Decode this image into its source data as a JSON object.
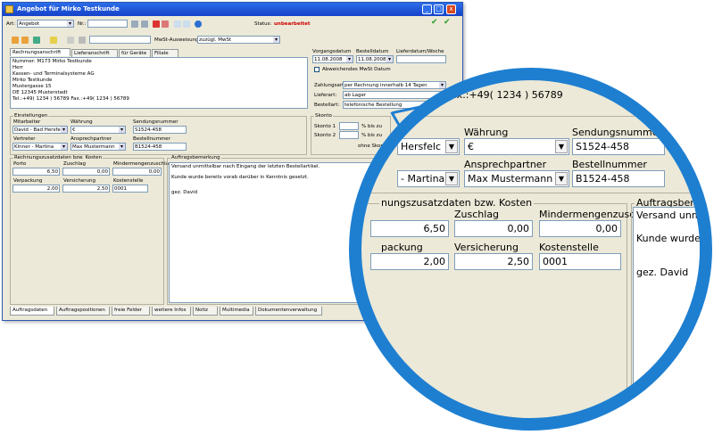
{
  "window": {
    "title": "Angebot für Mirko Testkunde",
    "min": "_",
    "max": "□",
    "close": "x"
  },
  "toolbar1": {
    "art_label": "Art:",
    "art_value": "Angebot",
    "nr_label": "Nr.:",
    "nr_value": "",
    "status_label": "Status:",
    "status_value": "unbearbeitet"
  },
  "toolbar2": {
    "mwst_label": "MwSt-Ausweisung:",
    "mwst_value": "zuzügl. MwSt"
  },
  "tabs": [
    "Rechnungsanschrift",
    "Lieferanschrift",
    "für Geräte",
    "Filiale"
  ],
  "address": {
    "lines": [
      "Nummer: M173  Mirko Testkunde",
      "Herr",
      "Kassen- und Terminalsysteme AG",
      "Mirko Testkunde",
      "Mustergasse 15",
      "DE 12345 Musterstadt",
      "Tel.:+49( 1234 ) 56789     Fax.:+49( 1234 ) 56789"
    ]
  },
  "dates": {
    "vorgang_label": "Vorgangsdatum",
    "vorgang_value": "11.08.2008",
    "bestell_label": "Bestelldatum",
    "bestell_value": "11.08.2008",
    "liefer_label": "Lieferdatum/Woche",
    "liefer_value": "",
    "abw_label": "Abweichendes MwSt Datum"
  },
  "payment": {
    "zahlungsart_label": "Zahlungsart:",
    "zahlungsart_value": "per Rechnung innerhalb 14 Tagen",
    "lieferart_label": "Lieferart:",
    "lieferart_value": "ab Lager",
    "bestellart_label": "Bestellart:",
    "bestellart_value": "telefonische Bestellung"
  },
  "settings": {
    "title": "Einstellungen",
    "mitarbeiter_label": "Mitarbeiter",
    "mitarbeiter_value": "David - Bad Hersfeld",
    "waehrung_label": "Währung",
    "waehrung_value": "€",
    "sendungsnummer_label": "Sendungsnummer",
    "sendungsnummer_value": "S1524-458",
    "vertreter_label": "Vertreter",
    "vertreter_value": "Kinner - Martina",
    "ansprech_label": "Ansprechpartner",
    "ansprech_value": "Max Mustermann",
    "bestellnummer_label": "Bestellnummer",
    "bestellnummer_value": "B1524-458"
  },
  "skonto": {
    "title": "Skonto",
    "s1_label": "Skonto 1",
    "s2_label": "Skonto 2",
    "pct_label": "% bis zu",
    "ohne_label": "ohne Skonto in"
  },
  "costs": {
    "title": "Rechnungszusatzdaten bzw. Kosten",
    "porto_label": "Porto",
    "porto_value": "6,50",
    "zuschlag_label": "Zuschlag",
    "zuschlag_value": "0,00",
    "minder_label": "Mindermengenzuschlag",
    "minder_value": "0,00",
    "verpackung_label": "Verpackung",
    "verpackung_value": "2,00",
    "versicherung_label": "Versicherung",
    "versicherung_value": "2,50",
    "kostenstelle_label": "Kostenstelle",
    "kostenstelle_value": "0001"
  },
  "remark": {
    "title": "Auftragsbemerkung",
    "line1": "Versand unmittelbar nach Eingang der letzten Bestellartikel.",
    "line2": "Kunde wurde bereits vorab darüber in Kenntnis gesetzt.",
    "line3": "gez. David"
  },
  "bottom_tabs": [
    "Auftragsdaten",
    "Auftragspositionen",
    "freie Felder",
    "weitere Infos",
    "Notiz",
    "Multimedia",
    "Dokumentenverwaltung"
  ],
  "zoom": {
    "tel_text": "ax.:+49( 1234 ) 56789",
    "mitarbeiter_value": "Hersfelc",
    "waehrung_label": "Währung",
    "waehrung_value": "€",
    "sendungsnummer_label": "Sendungsnummer",
    "sendungsnummer_value": "S1524-458",
    "ansprech_label": "Ansprechpartner",
    "ansprech_value": "Max Mustermann",
    "bestellnummer_label": "Bestellnummer",
    "bestellnummer_value": "B1524-458",
    "vertreter_value": "- Martina",
    "costs_title": "nungszusatzdaten bzw. Kosten",
    "zuschlag_label": "Zuschlag",
    "minder_label": "Mindermengenzuschlag",
    "porto_value": "6,50",
    "zuschlag_value": "0,00",
    "minder_value": "0,00",
    "verpackung_label": "packung",
    "versicherung_label": "Versicherung",
    "kostenstelle_label": "Kostenstelle",
    "verpackung_value": "2,00",
    "versicherung_value": "2,50",
    "kostenstelle_value": "0001",
    "remark_title": "Auftragsbemerkung",
    "remark_line1": "Versand unmittel",
    "remark_line2": "Kunde wurde bere",
    "remark_line3": "gez. David"
  },
  "colors": {
    "accent": "#1e7fd1",
    "titlebar": "#1542c9",
    "status": "#cc0000",
    "window_bg": "#ece9d8"
  }
}
